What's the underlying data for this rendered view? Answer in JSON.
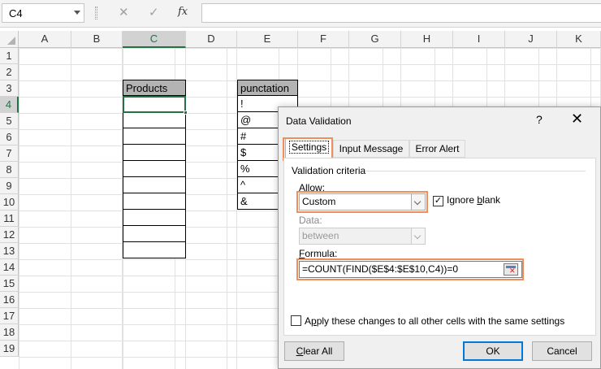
{
  "formula_bar": {
    "name_box": "C4",
    "cancel_glyph": "✕",
    "enter_glyph": "✓",
    "fx_label": "fx",
    "formula": ""
  },
  "columns": [
    "A",
    "B",
    "C",
    "D",
    "E",
    "F",
    "G",
    "H",
    "I",
    "J",
    "K"
  ],
  "rows": [
    "1",
    "2",
    "3",
    "4",
    "5",
    "6",
    "7",
    "8",
    "9",
    "10",
    "11",
    "12",
    "13",
    "14",
    "15",
    "16",
    "17",
    "18",
    "19"
  ],
  "sheet": {
    "products_header": "Products",
    "punctuation_header": "punctation",
    "punctuation_values": [
      "!",
      "@",
      "#",
      "$",
      "%",
      "^",
      "&"
    ]
  },
  "dialog": {
    "title": "Data Validation",
    "help": "?",
    "close": "✕",
    "tabs": [
      "Settings",
      "Input Message",
      "Error Alert"
    ],
    "group_label": "Validation criteria",
    "allow_label_u": "A",
    "allow_label_rest": "llow:",
    "allow_value": "Custom",
    "ignore_blank_pre": "Ignore ",
    "ignore_blank_u": "b",
    "ignore_blank_post": "lank",
    "ignore_blank_checked": "✓",
    "data_label": "Data:",
    "data_value": "between",
    "formula_label_u": "F",
    "formula_label_rest": "ormula:",
    "formula_value": "=COUNT(FIND($E$4:$E$10,C4))=0",
    "apply_pre": "A",
    "apply_u": "p",
    "apply_post": "ply these changes to all other cells with the same settings",
    "clear_all_pre": "",
    "clear_all_u": "C",
    "clear_all_post": "lear All",
    "ok_label": "OK",
    "cancel_label": "Cancel"
  },
  "colors": {
    "excel_green": "#217346",
    "highlight_orange": "#ef8f5b",
    "header_gray": "#b3b3b3"
  }
}
